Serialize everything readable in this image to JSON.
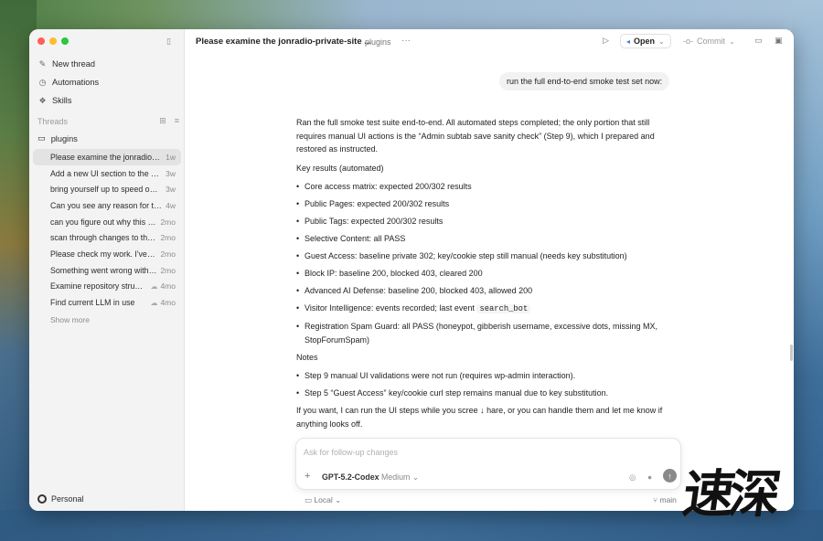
{
  "window": {
    "title": "Please examine the jonradio-private-site ...",
    "crumb": "plugins",
    "more": "···"
  },
  "toolbar": {
    "open_label": "Open",
    "commit_label": "Commit"
  },
  "sidebar": {
    "nav": [
      {
        "icon": "new-thread-icon",
        "glyph": "✎",
        "label": "New thread"
      },
      {
        "icon": "clock-icon",
        "glyph": "◷",
        "label": "Automations"
      },
      {
        "icon": "skills-icon",
        "glyph": "❖",
        "label": "Skills"
      }
    ],
    "threads_header": "Threads",
    "folder": "plugins",
    "threads": [
      {
        "title": "Please examine the jonradio-private-site",
        "age": "1w",
        "cloud": false,
        "active": true
      },
      {
        "title": "Add a new UI section to the settings page",
        "age": "3w",
        "cloud": false,
        "active": false
      },
      {
        "title": "bring yourself up to speed on the repo",
        "age": "3w",
        "cloud": false,
        "active": false
      },
      {
        "title": "Can you see any reason for the failure",
        "age": "4w",
        "cloud": false,
        "active": false
      },
      {
        "title": "can you figure out why this is failing",
        "age": "2mo",
        "cloud": false,
        "active": false
      },
      {
        "title": "scan through changes to the plugin",
        "age": "2mo",
        "cloud": false,
        "active": false
      },
      {
        "title": "Please check my work. I've made changes",
        "age": "2mo",
        "cloud": false,
        "active": false
      },
      {
        "title": "Something went wrong with the build",
        "age": "2mo",
        "cloud": false,
        "active": false
      },
      {
        "title": "Examine repository structure",
        "age": "4mo",
        "cloud": true,
        "active": false
      },
      {
        "title": "Find current LLM in use",
        "age": "4mo",
        "cloud": true,
        "active": false
      }
    ],
    "show_more": "Show more",
    "profile": "Personal"
  },
  "conversation": {
    "user_message": "run the full end-to-end smoke test set now:",
    "intro": "Ran the full smoke test suite end-to-end. All automated steps completed; the only portion that still requires manual UI actions is the “Admin subtab save sanity check” (Step 9), which I prepared and restored as instructed.",
    "key_results_heading": "Key results (automated)",
    "key_results": [
      "Core access matrix: expected 200/302 results",
      "Public Pages: expected 200/302 results",
      "Public Tags: expected 200/302 results",
      "Selective Content: all PASS",
      "Guest Access: baseline private 302; key/cookie step still manual (needs key substitution)",
      "Block IP: baseline 200, blocked 403, cleared 200",
      "Advanced AI Defense: baseline 200, blocked 403, allowed 200",
      "Registration Spam Guard: all PASS (honeypot, gibberish username, excessive dots, missing MX, StopForumSpam)"
    ],
    "visitor_prefix": "Visitor Intelligence: events recorded; last event",
    "visitor_code": "search_bot",
    "notes_heading": "Notes",
    "notes": [
      "Step 9 manual UI validations were not run (requires wp-admin interaction).",
      "Step 5 “Guest Access” key/cookie curl step remains manual due to key substitution."
    ],
    "closing": "If you want, I can run the UI steps while you scree ↓ hare, or you can handle them and let me know if anything looks off."
  },
  "composer": {
    "placeholder": "Ask for follow-up changes",
    "model": "GPT-5.2-Codex",
    "effort": "Medium",
    "env": "Local",
    "branch": "main"
  },
  "watermark": {
    "text": "速深"
  }
}
